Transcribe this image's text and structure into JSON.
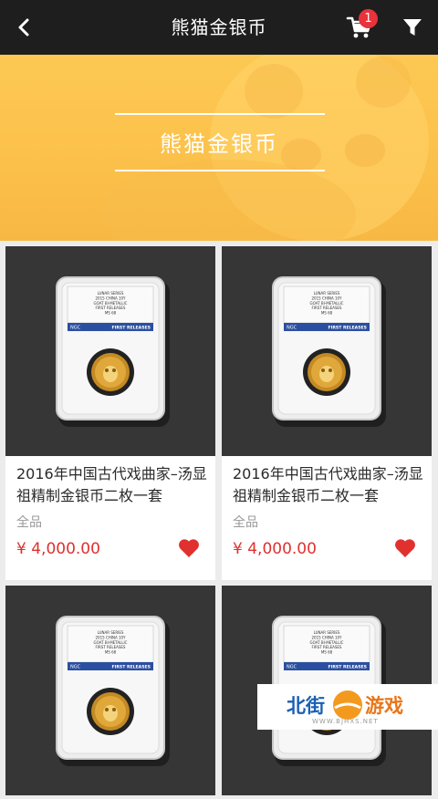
{
  "header": {
    "title": "熊猫金银币",
    "cart_count": "1"
  },
  "banner": {
    "title": "熊猫金银币"
  },
  "products": [
    {
      "name": "2016年中国古代戏曲家–汤显祖精制金银币二枚一套",
      "condition": "全品",
      "price": "¥ 4,000.00"
    },
    {
      "name": "2016年中国古代戏曲家–汤显祖精制金银币二枚一套",
      "condition": "全品",
      "price": "¥ 4,000.00"
    },
    {
      "name": "",
      "condition": "",
      "price": ""
    },
    {
      "name": "",
      "condition": "",
      "price": ""
    }
  ],
  "slab_label": {
    "lines": [
      "LUNAR SERIES",
      "2015 CHINA 10Y",
      "GOAT BI-METALLIC",
      "FIRST RELEASES",
      "MS 68"
    ],
    "brand": "NGC",
    "band": "FIRST RELEASES"
  },
  "watermark": {
    "part1": "北街",
    "part2": "游戏",
    "url": "WWW.BJHXS.NET"
  },
  "colors": {
    "header_bg": "#1e1e1e",
    "accent_red": "#e0312f",
    "banner": "#fbc04a",
    "card_image_bg": "#363636"
  }
}
